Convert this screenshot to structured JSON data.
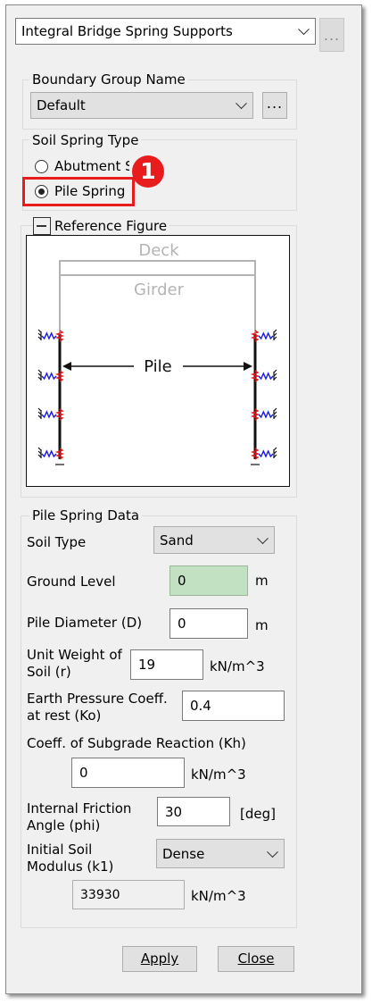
{
  "support_type": {
    "value": "Integral Bridge Spring Supports",
    "more": "..."
  },
  "boundary_group": {
    "label": "Boundary Group Name",
    "value": "Default",
    "more": "..."
  },
  "soil_spring_type": {
    "label": "Soil Spring Type",
    "options": [
      {
        "label": "Abutment S",
        "selected": false
      },
      {
        "label": "Pile Spring",
        "selected": true
      }
    ],
    "callout_number": "1"
  },
  "reference_figure": {
    "label": "Reference Figure",
    "deck_label": "Deck",
    "girder_label": "Girder",
    "pile_label": "Pile"
  },
  "pile_spring_data": {
    "label": "Pile Spring Data",
    "soil_type": {
      "label": "Soil Type",
      "value": "Sand"
    },
    "ground_level": {
      "label": "Ground Level",
      "value": "0",
      "unit": "m"
    },
    "pile_diameter": {
      "label": "Pile Diameter (D)",
      "value": "0",
      "unit": "m"
    },
    "unit_weight": {
      "label_line1": "Unit Weight of",
      "label_line2": "Soil (r)",
      "value": "19",
      "unit": "kN/m^3"
    },
    "earth_pressure": {
      "label_line1": "Earth Pressure Coeff.",
      "label_line2": "at rest (Ko)",
      "value": "0.4"
    },
    "subgrade": {
      "label": "Coeff. of Subgrade Reaction (Kh)",
      "value": "0",
      "unit": "kN/m^3"
    },
    "friction_angle": {
      "label_line1": "Internal Friction",
      "label_line2": "Angle (phi)",
      "value": "30",
      "unit": "[deg]"
    },
    "initial_modulus": {
      "label_line1": "Initial Soil",
      "label_line2": "Modulus (k1)",
      "value": "Dense",
      "computed": "33930",
      "unit": "kN/m^3"
    }
  },
  "buttons": {
    "apply": "Apply",
    "close": "Close"
  },
  "colors": {
    "accent_red": "#e81c1c",
    "ground_green": "#c2e1c2",
    "spring_red": "#e81c1c",
    "spring_blue": "#1a1ae6"
  }
}
